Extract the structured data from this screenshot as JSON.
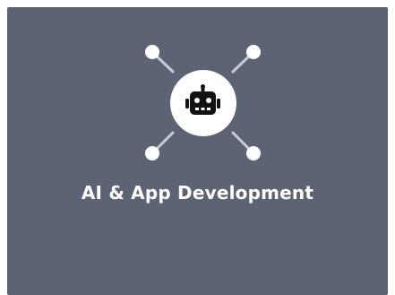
{
  "card": {
    "title": "AI & App Development",
    "icon": "robot-icon",
    "background_color": "#5c6473",
    "circle_color": "#ffffff",
    "connector_color": "#c9ccd2",
    "node_color": "#ffffff",
    "icon_color": "#111111"
  }
}
